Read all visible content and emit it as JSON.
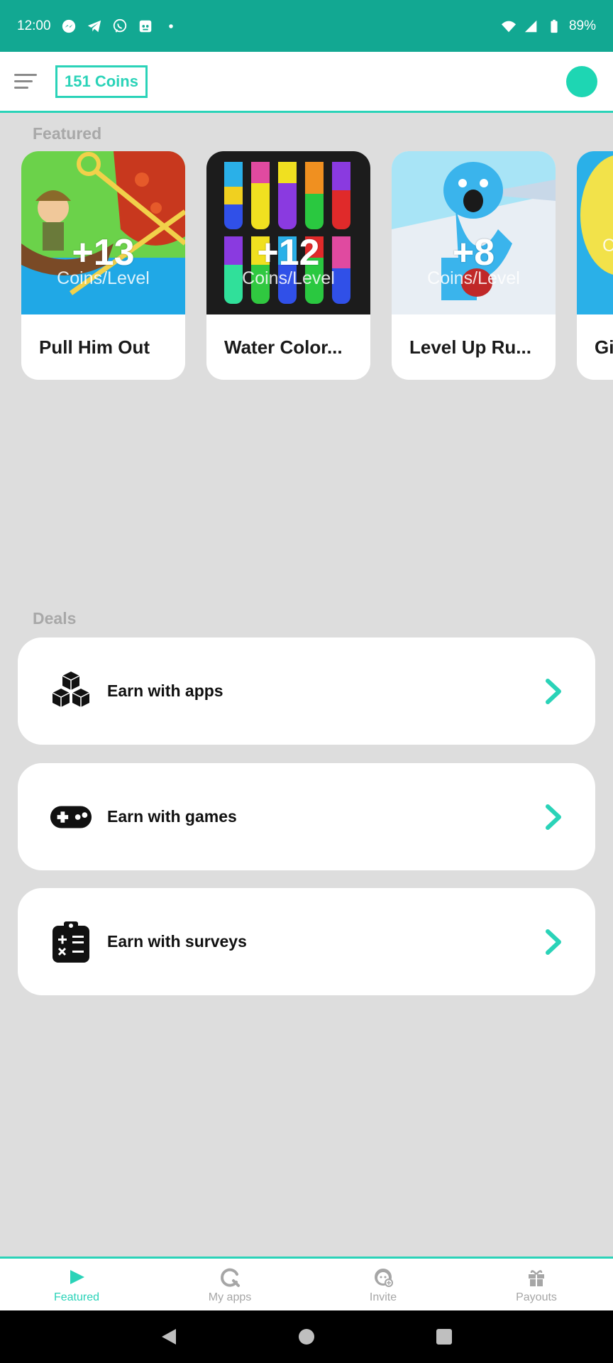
{
  "status_bar": {
    "time": "12:00",
    "battery": "89%",
    "left_icons": [
      "messenger-icon",
      "telegram-icon",
      "viber-icon",
      "calendar-app-icon",
      "dot-icon"
    ],
    "right_icons": [
      "wifi-icon",
      "signal-icon",
      "battery-icon"
    ]
  },
  "header": {
    "coins_label": "151 Coins"
  },
  "featured": {
    "section_label": "Featured",
    "cards": [
      {
        "title": "Pull Him Out",
        "coins": "+13",
        "coins_label": "Coins/Level"
      },
      {
        "title": "Water Color...",
        "coins": "+12",
        "coins_label": "Coins/Level"
      },
      {
        "title": "Level Up Ru...",
        "coins": "+8",
        "coins_label": "Coins/Level"
      },
      {
        "title": "Gi",
        "coins": "",
        "coins_label": "C"
      }
    ]
  },
  "deals": {
    "section_label": "Deals",
    "items": [
      {
        "label": "Earn with apps",
        "icon": "cubes-icon"
      },
      {
        "label": "Earn with games",
        "icon": "gamepad-icon"
      },
      {
        "label": "Earn with surveys",
        "icon": "clipboard-icon"
      }
    ]
  },
  "bottom_nav": {
    "items": [
      {
        "label": "Featured",
        "icon": "play-icon",
        "active": true
      },
      {
        "label": "My apps",
        "icon": "refresh-icon",
        "active": false
      },
      {
        "label": "Invite",
        "icon": "invite-face-icon",
        "active": false
      },
      {
        "label": "Payouts",
        "icon": "gift-icon",
        "active": false
      }
    ]
  },
  "colors": {
    "status_bar": "#12a892",
    "accent": "#2ad3b8",
    "background": "#dddddd",
    "section_label": "#a8a8a8"
  }
}
